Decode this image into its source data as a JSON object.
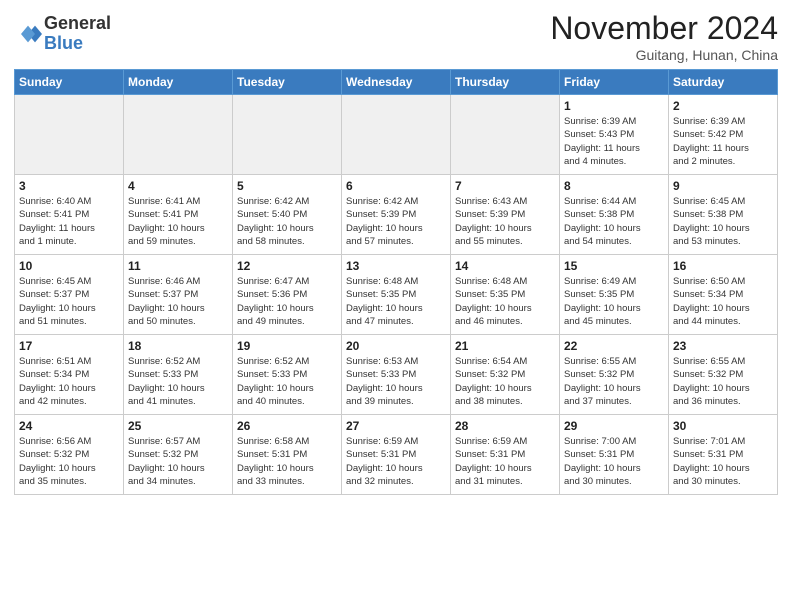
{
  "header": {
    "logo_general": "General",
    "logo_blue": "Blue",
    "month": "November 2024",
    "location": "Guitang, Hunan, China"
  },
  "weekdays": [
    "Sunday",
    "Monday",
    "Tuesday",
    "Wednesday",
    "Thursday",
    "Friday",
    "Saturday"
  ],
  "weeks": [
    [
      {
        "day": "",
        "info": ""
      },
      {
        "day": "",
        "info": ""
      },
      {
        "day": "",
        "info": ""
      },
      {
        "day": "",
        "info": ""
      },
      {
        "day": "",
        "info": ""
      },
      {
        "day": "1",
        "info": "Sunrise: 6:39 AM\nSunset: 5:43 PM\nDaylight: 11 hours\nand 4 minutes."
      },
      {
        "day": "2",
        "info": "Sunrise: 6:39 AM\nSunset: 5:42 PM\nDaylight: 11 hours\nand 2 minutes."
      }
    ],
    [
      {
        "day": "3",
        "info": "Sunrise: 6:40 AM\nSunset: 5:41 PM\nDaylight: 11 hours\nand 1 minute."
      },
      {
        "day": "4",
        "info": "Sunrise: 6:41 AM\nSunset: 5:41 PM\nDaylight: 10 hours\nand 59 minutes."
      },
      {
        "day": "5",
        "info": "Sunrise: 6:42 AM\nSunset: 5:40 PM\nDaylight: 10 hours\nand 58 minutes."
      },
      {
        "day": "6",
        "info": "Sunrise: 6:42 AM\nSunset: 5:39 PM\nDaylight: 10 hours\nand 57 minutes."
      },
      {
        "day": "7",
        "info": "Sunrise: 6:43 AM\nSunset: 5:39 PM\nDaylight: 10 hours\nand 55 minutes."
      },
      {
        "day": "8",
        "info": "Sunrise: 6:44 AM\nSunset: 5:38 PM\nDaylight: 10 hours\nand 54 minutes."
      },
      {
        "day": "9",
        "info": "Sunrise: 6:45 AM\nSunset: 5:38 PM\nDaylight: 10 hours\nand 53 minutes."
      }
    ],
    [
      {
        "day": "10",
        "info": "Sunrise: 6:45 AM\nSunset: 5:37 PM\nDaylight: 10 hours\nand 51 minutes."
      },
      {
        "day": "11",
        "info": "Sunrise: 6:46 AM\nSunset: 5:37 PM\nDaylight: 10 hours\nand 50 minutes."
      },
      {
        "day": "12",
        "info": "Sunrise: 6:47 AM\nSunset: 5:36 PM\nDaylight: 10 hours\nand 49 minutes."
      },
      {
        "day": "13",
        "info": "Sunrise: 6:48 AM\nSunset: 5:35 PM\nDaylight: 10 hours\nand 47 minutes."
      },
      {
        "day": "14",
        "info": "Sunrise: 6:48 AM\nSunset: 5:35 PM\nDaylight: 10 hours\nand 46 minutes."
      },
      {
        "day": "15",
        "info": "Sunrise: 6:49 AM\nSunset: 5:35 PM\nDaylight: 10 hours\nand 45 minutes."
      },
      {
        "day": "16",
        "info": "Sunrise: 6:50 AM\nSunset: 5:34 PM\nDaylight: 10 hours\nand 44 minutes."
      }
    ],
    [
      {
        "day": "17",
        "info": "Sunrise: 6:51 AM\nSunset: 5:34 PM\nDaylight: 10 hours\nand 42 minutes."
      },
      {
        "day": "18",
        "info": "Sunrise: 6:52 AM\nSunset: 5:33 PM\nDaylight: 10 hours\nand 41 minutes."
      },
      {
        "day": "19",
        "info": "Sunrise: 6:52 AM\nSunset: 5:33 PM\nDaylight: 10 hours\nand 40 minutes."
      },
      {
        "day": "20",
        "info": "Sunrise: 6:53 AM\nSunset: 5:33 PM\nDaylight: 10 hours\nand 39 minutes."
      },
      {
        "day": "21",
        "info": "Sunrise: 6:54 AM\nSunset: 5:32 PM\nDaylight: 10 hours\nand 38 minutes."
      },
      {
        "day": "22",
        "info": "Sunrise: 6:55 AM\nSunset: 5:32 PM\nDaylight: 10 hours\nand 37 minutes."
      },
      {
        "day": "23",
        "info": "Sunrise: 6:55 AM\nSunset: 5:32 PM\nDaylight: 10 hours\nand 36 minutes."
      }
    ],
    [
      {
        "day": "24",
        "info": "Sunrise: 6:56 AM\nSunset: 5:32 PM\nDaylight: 10 hours\nand 35 minutes."
      },
      {
        "day": "25",
        "info": "Sunrise: 6:57 AM\nSunset: 5:32 PM\nDaylight: 10 hours\nand 34 minutes."
      },
      {
        "day": "26",
        "info": "Sunrise: 6:58 AM\nSunset: 5:31 PM\nDaylight: 10 hours\nand 33 minutes."
      },
      {
        "day": "27",
        "info": "Sunrise: 6:59 AM\nSunset: 5:31 PM\nDaylight: 10 hours\nand 32 minutes."
      },
      {
        "day": "28",
        "info": "Sunrise: 6:59 AM\nSunset: 5:31 PM\nDaylight: 10 hours\nand 31 minutes."
      },
      {
        "day": "29",
        "info": "Sunrise: 7:00 AM\nSunset: 5:31 PM\nDaylight: 10 hours\nand 30 minutes."
      },
      {
        "day": "30",
        "info": "Sunrise: 7:01 AM\nSunset: 5:31 PM\nDaylight: 10 hours\nand 30 minutes."
      }
    ]
  ]
}
